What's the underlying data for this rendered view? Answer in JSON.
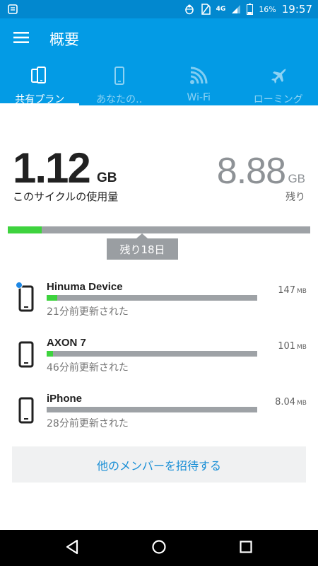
{
  "status_bar": {
    "net_type": "4G",
    "battery": "16%",
    "time": "19:57"
  },
  "app_bar": {
    "title": "概要",
    "menu_icon": "hamburger-menu-icon"
  },
  "tabs": [
    {
      "label": "共有プラン",
      "icon": "shared-devices-icon",
      "active": true
    },
    {
      "label": "あなたの‥",
      "icon": "phone-icon",
      "active": false
    },
    {
      "label": "Wi-Fi",
      "icon": "wifi-icon",
      "active": false
    },
    {
      "label": "ローミング",
      "icon": "airplane-icon",
      "active": false
    }
  ],
  "usage": {
    "used_value": "1.12",
    "used_unit": "GB",
    "used_caption": "このサイクルの使用量",
    "remaining_value": "8.88",
    "remaining_unit": "GB",
    "remaining_caption": "残り",
    "cycle_fraction": 0.112,
    "days_left": "残り18日"
  },
  "devices": [
    {
      "name": "Hinuma Device",
      "usage_value": "147",
      "usage_unit": "MB",
      "updated": "21分前更新された",
      "fraction": 0.05,
      "badge": true
    },
    {
      "name": "AXON 7",
      "usage_value": "101",
      "usage_unit": "MB",
      "updated": "46分前更新された",
      "fraction": 0.03,
      "badge": false
    },
    {
      "name": "iPhone",
      "usage_value": "8.04",
      "usage_unit": "MB",
      "updated": "28分前更新された",
      "fraction": 0.0,
      "badge": false
    }
  ],
  "invite_button": "他のメンバーを招待する",
  "colors": {
    "primary": "#039be5",
    "status_bar": "#0288cf",
    "usage_green": "#3ed33e",
    "bar_gray": "#9ea2a6",
    "link_blue": "#1a8fd6"
  }
}
